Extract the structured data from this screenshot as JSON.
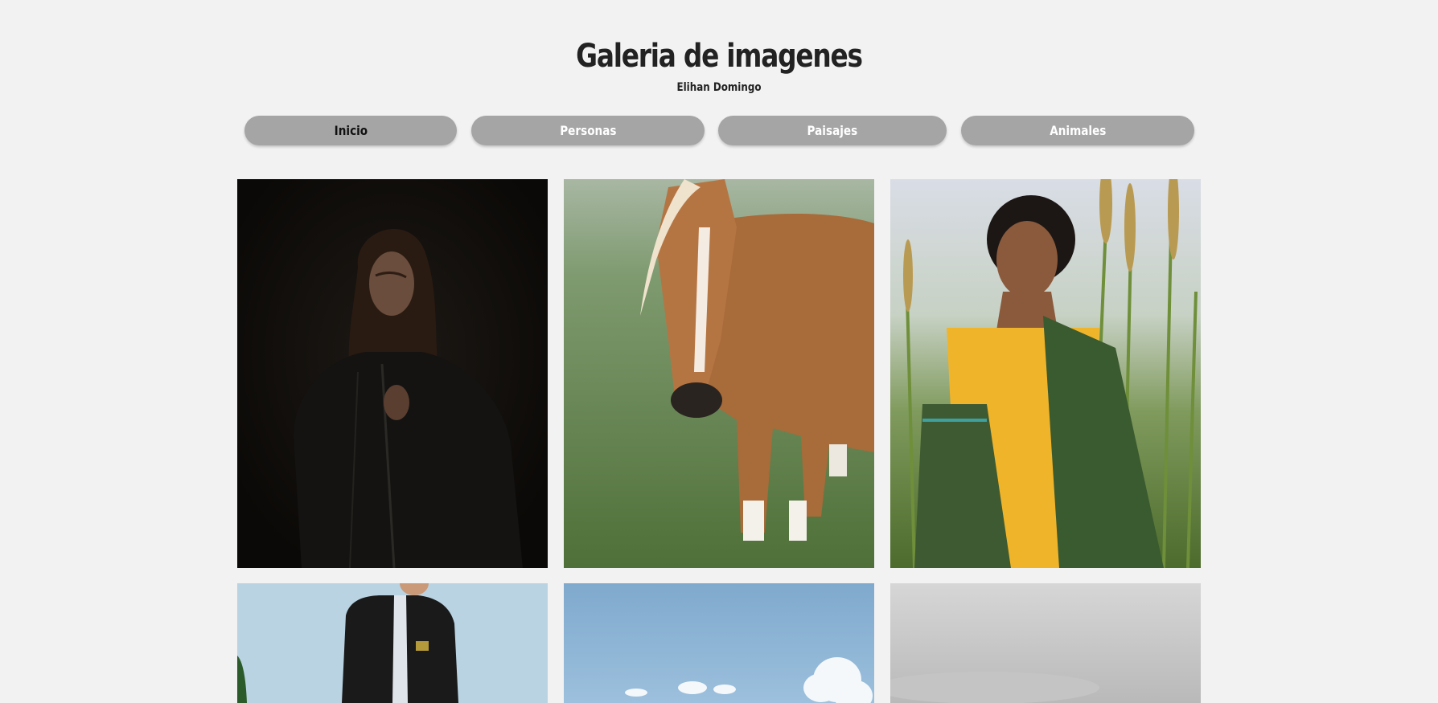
{
  "header": {
    "title": "Galeria de imagenes",
    "subtitle": "Elihan Domingo"
  },
  "nav": {
    "items": [
      {
        "label": "Inicio",
        "active": true
      },
      {
        "label": "Personas",
        "active": false
      },
      {
        "label": "Paisajes",
        "active": false
      },
      {
        "label": "Animales",
        "active": false
      }
    ]
  },
  "gallery": {
    "images": [
      {
        "name": "woman-leather-jacket-photo"
      },
      {
        "name": "horse-in-field-photo"
      },
      {
        "name": "woman-in-wheat-field-photo"
      },
      {
        "name": "man-bomber-jacket-photo"
      },
      {
        "name": "blue-sky-clouds-photo"
      },
      {
        "name": "overcast-sky-photo"
      }
    ]
  }
}
